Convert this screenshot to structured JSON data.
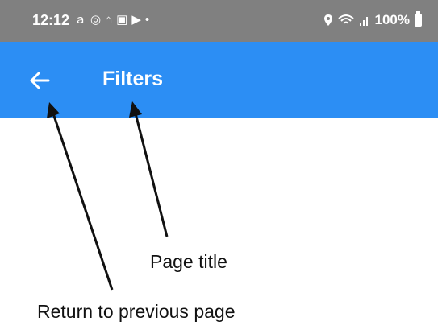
{
  "status_bar": {
    "time": "12:12",
    "left_icons": [
      "amazon-icon",
      "account-icon",
      "home-icon",
      "calendar-icon",
      "play-icon",
      "dot-icon"
    ],
    "battery_text": "100%",
    "right_icons": [
      "location-icon",
      "wifi-icon",
      "signal-icon",
      "battery-icon"
    ]
  },
  "app_bar": {
    "title": "Filters",
    "back_icon": "arrow-left-icon",
    "color": "#2c8ef4"
  },
  "annotations": {
    "page_title_label": "Page title",
    "return_label": "Return to previous page"
  }
}
